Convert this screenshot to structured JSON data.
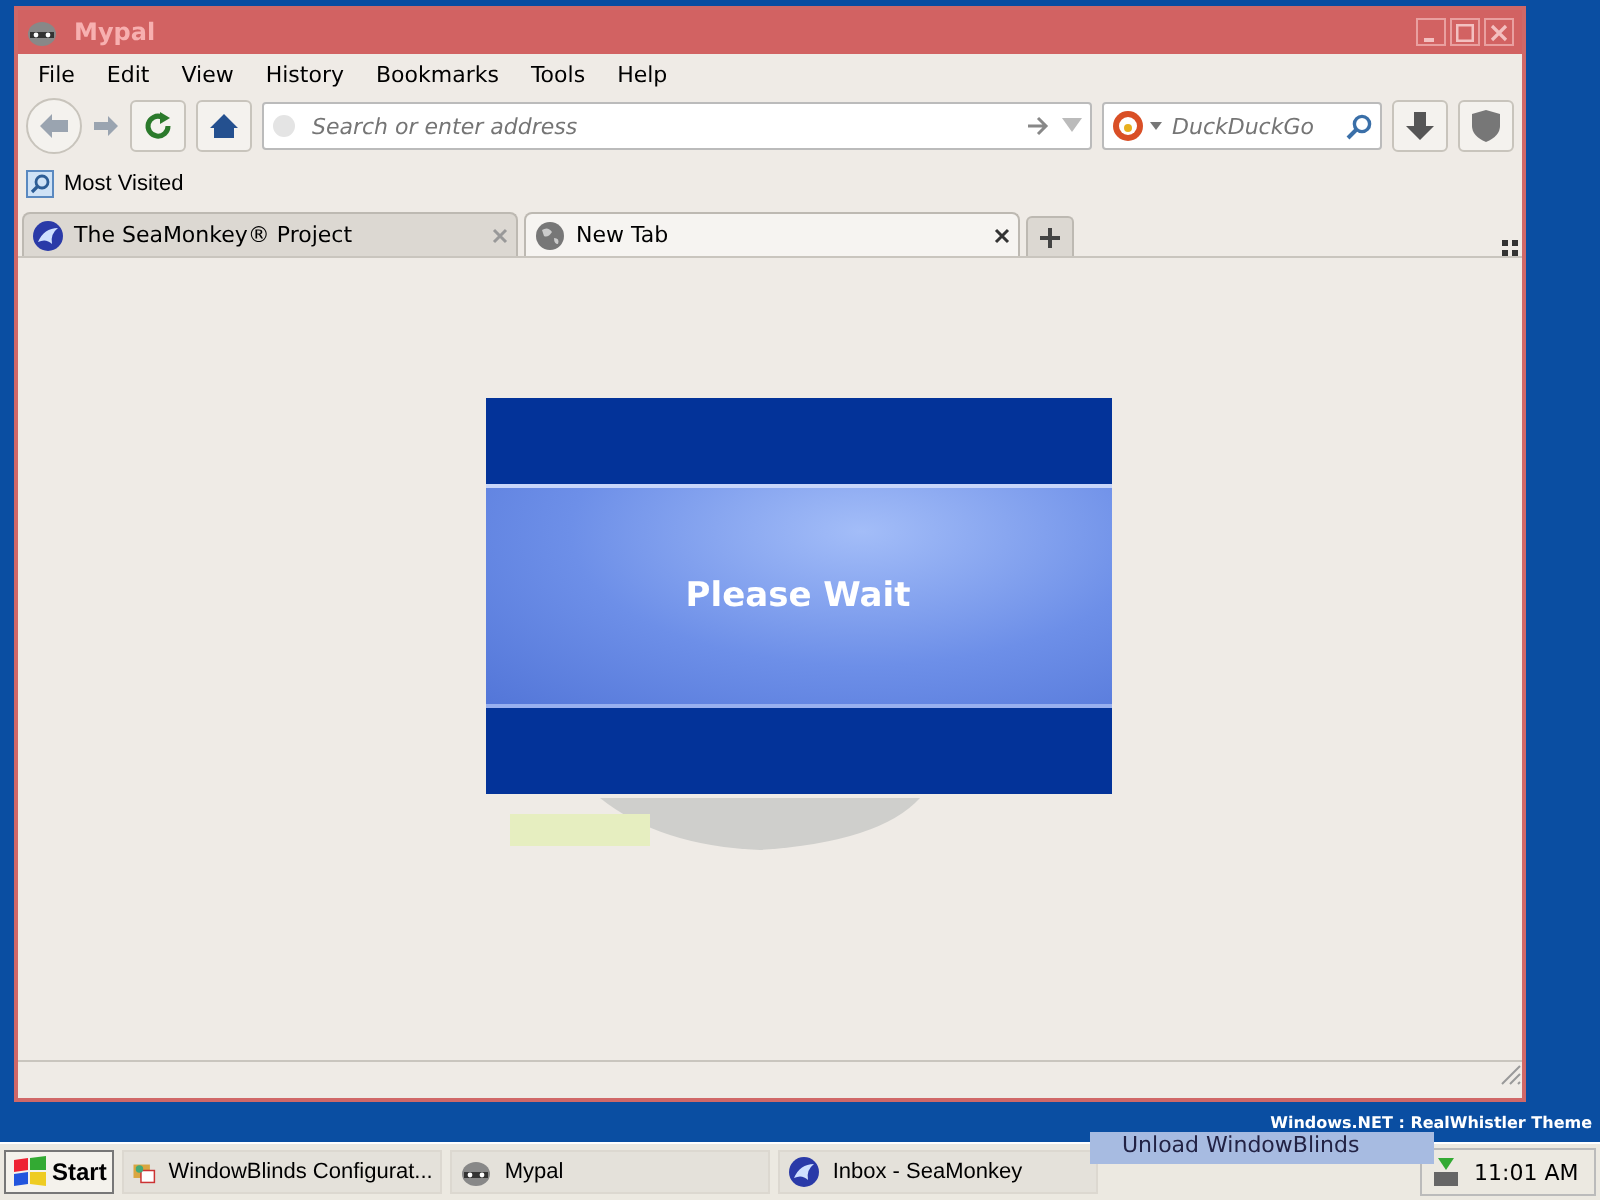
{
  "window": {
    "title": "Mypal"
  },
  "menu": [
    "File",
    "Edit",
    "View",
    "History",
    "Bookmarks",
    "Tools",
    "Help"
  ],
  "address": {
    "placeholder": "Search or enter address"
  },
  "search": {
    "placeholder": "DuckDuckGo"
  },
  "bookmarks": [
    "Most Visited"
  ],
  "tabs": [
    {
      "label": "The SeaMonkey® Project",
      "selected": false,
      "kind": "seamonkey"
    },
    {
      "label": "New Tab",
      "selected": true,
      "kind": "globe"
    }
  ],
  "dialog": {
    "message": "Please Wait"
  },
  "desktop_caption": "Windows.NET : RealWhistler Theme",
  "tooltip": "Unload WindowBlinds",
  "taskbar": {
    "start": "Start",
    "tasks": [
      {
        "label": "WindowBlinds Configurat...",
        "kind": "config",
        "selected": false
      },
      {
        "label": "Mypal",
        "kind": "raccoon",
        "selected": false
      },
      {
        "label": "Inbox - SeaMonkey",
        "kind": "seamonkey",
        "selected": false
      }
    ],
    "clock": "11:01 AM"
  }
}
